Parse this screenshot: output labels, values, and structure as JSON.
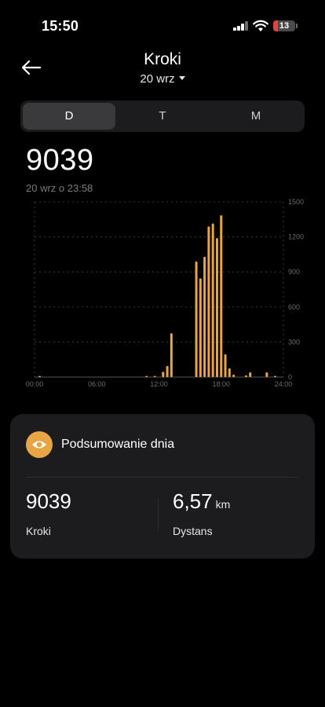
{
  "status_bar": {
    "time": "15:50",
    "battery": "13"
  },
  "header": {
    "title": "Kroki",
    "date": "20 wrz"
  },
  "tabs": [
    {
      "label": "D",
      "active": true
    },
    {
      "label": "T",
      "active": false
    },
    {
      "label": "M",
      "active": false
    }
  ],
  "total": {
    "value": "9039",
    "timestamp": "20 wrz o 23:58"
  },
  "colors": {
    "accent": "#e8a545",
    "card": "#1c1c1e",
    "background": "#000000"
  },
  "chart_data": {
    "type": "bar",
    "title": "",
    "xlabel": "",
    "ylabel": "",
    "x_ticks": [
      "00:00",
      "06:00",
      "12:00",
      "18:00",
      "24:00"
    ],
    "y_ticks": [
      "0",
      "300",
      "600",
      "900",
      "1200",
      "1500"
    ],
    "xlim": [
      0,
      24
    ],
    "ylim": [
      0,
      1500
    ],
    "grid": true,
    "y_axis_side": "right",
    "bar_color": "#e8a545",
    "x": [
      0.5,
      10.8,
      11.6,
      12.4,
      12.8,
      13.2,
      15.6,
      16.0,
      16.4,
      16.8,
      17.2,
      17.6,
      18.0,
      18.4,
      18.8,
      19.2,
      20.4,
      20.8,
      22.4,
      23.2
    ],
    "values": [
      6,
      5,
      8,
      45,
      95,
      375,
      990,
      845,
      1030,
      1290,
      1315,
      1190,
      1385,
      195,
      75,
      20,
      15,
      40,
      40,
      10
    ]
  },
  "summary": {
    "title": "Podsumowanie dnia",
    "icon": "eye-icon",
    "steps_value": "9039",
    "steps_label": "Kroki",
    "distance_value": "6,57",
    "distance_unit": "km",
    "distance_label": "Dystans"
  }
}
